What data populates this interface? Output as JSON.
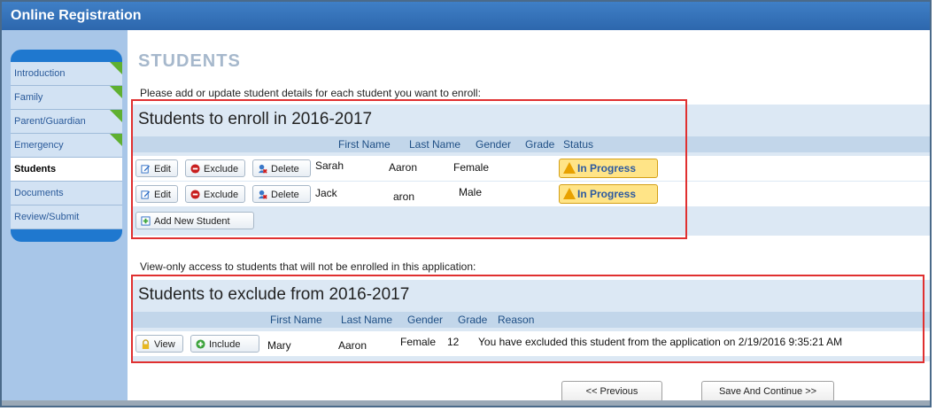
{
  "app": {
    "title": "Online Registration"
  },
  "nav": {
    "items": [
      {
        "label": "Introduction",
        "done": true
      },
      {
        "label": "Family",
        "done": true
      },
      {
        "label": "Parent/Guardian",
        "done": true
      },
      {
        "label": "Emergency",
        "done": true
      },
      {
        "label": "Students",
        "active": true
      },
      {
        "label": "Documents"
      },
      {
        "label": "Review/Submit"
      }
    ]
  },
  "page": {
    "heading": "STUDENTS",
    "intro": "Please add or update student details for each student you want to enroll:",
    "view_only_text": "View-only access to students that will not be enrolled in this application:"
  },
  "enroll": {
    "title": "Students to enroll in 2016-2017",
    "columns": [
      "First Name",
      "Last Name",
      "Gender",
      "Grade",
      "Status"
    ],
    "rows": [
      {
        "first": "Sarah",
        "last": "Aaron",
        "gender": "Female",
        "grade": "",
        "status": "In Progress"
      },
      {
        "first": "Jack",
        "last": "aron",
        "gender": "Male",
        "grade": "",
        "status": "In Progress"
      }
    ],
    "buttons": {
      "edit": "Edit",
      "exclude": "Exclude",
      "delete": "Delete",
      "add": "Add New Student"
    }
  },
  "exclude": {
    "title": "Students to exclude from 2016-2017",
    "columns": [
      "First Name",
      "Last Name",
      "Gender",
      "Grade",
      "Reason"
    ],
    "rows": [
      {
        "first": "Mary",
        "last": "Aaron",
        "gender": "Female",
        "grade": "12",
        "reason": "You have excluded this student from the application on 2/19/2016 9:35:21 AM"
      }
    ],
    "buttons": {
      "view": "View",
      "include": "Include"
    }
  },
  "footer": {
    "previous": "<< Previous",
    "save": "Save And Continue >>"
  },
  "colors": {
    "title_bar": "#2d67ad",
    "nav_bg": "#1f78cf",
    "status_bg": "#ffe487",
    "highlight_box": "#e03030"
  }
}
